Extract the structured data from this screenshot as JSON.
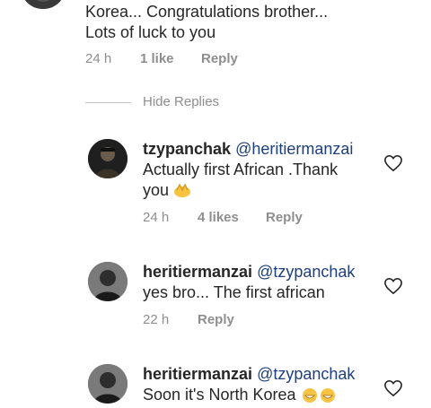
{
  "top_comment": {
    "text_line1": "Korea... Congratulations brother...",
    "text_line2": "Lots of luck to you",
    "time": "24 h",
    "likes": "1 like",
    "reply": "Reply"
  },
  "hide_replies": "Hide Replies",
  "replies": [
    {
      "username": "tzypanchak",
      "mention": "@heritiermanzai",
      "text_line1": "Actually first African .Thank",
      "text_line2": "you",
      "time": "24 h",
      "likes": "4 likes",
      "reply": "Reply"
    },
    {
      "username": "heritiermanzai",
      "mention": "@tzypanchak",
      "text_line1": "yes bro... The first african",
      "time": "22 h",
      "reply": "Reply"
    },
    {
      "username": "heritiermanzai",
      "mention": "@tzypanchak",
      "text_line1": "Soon it's North Korea"
    }
  ],
  "icons": {
    "heart": "heart-outline-icon",
    "clap": "clapping-hands-emoji",
    "grin": "grinning-emoji"
  },
  "colors": {
    "text": "#262626",
    "meta": "#8e8e8e",
    "mention": "#1e3f7a"
  }
}
